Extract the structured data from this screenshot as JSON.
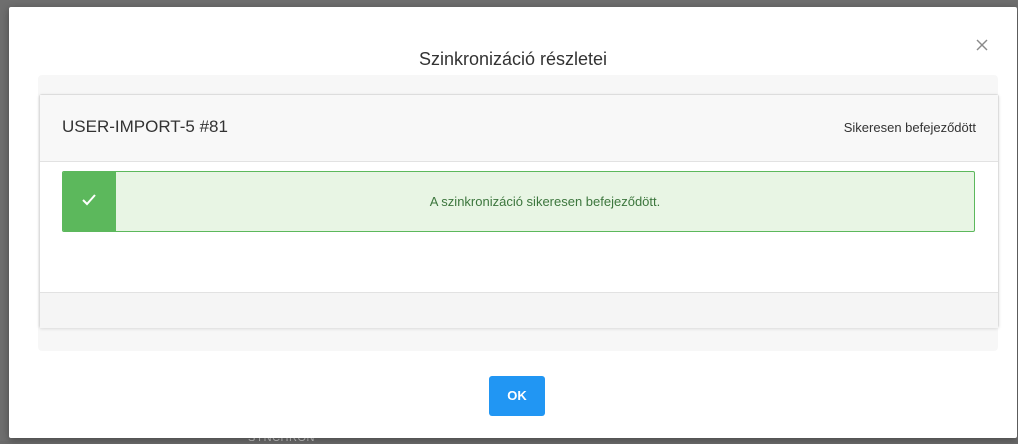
{
  "behind": {
    "text": "SYNCHRON"
  },
  "modal": {
    "title": "Szinkronizáció részletei",
    "close_icon": "close-icon"
  },
  "sync_card": {
    "job_name": "USER-IMPORT-5 #81",
    "status": "Sikeresen befejeződött"
  },
  "alert": {
    "type": "success",
    "icon": "checkmark-icon",
    "message": "A szinkronizáció sikeresen befejeződött.",
    "color": "#5cb85c"
  },
  "footer": {
    "ok_label": "OK",
    "ok_color": "#2196f3"
  }
}
